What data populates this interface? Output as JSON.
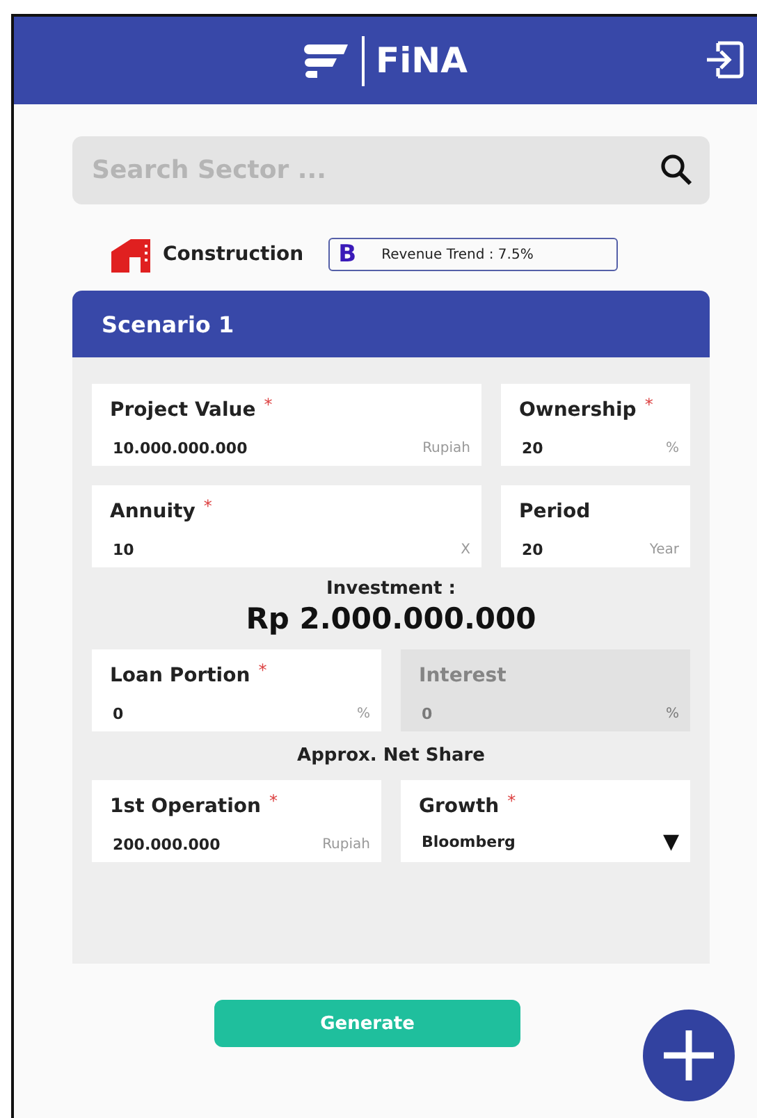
{
  "header": {
    "title": "FiNA"
  },
  "search": {
    "placeholder": "Search Sector ..."
  },
  "sector": {
    "name": "Construction",
    "badge_letter": "B",
    "trend": "Revenue Trend : 7.5%"
  },
  "scenario": {
    "title": "Scenario 1",
    "rows": [
      {
        "kind": "split",
        "fields": [
          {
            "kind": "input",
            "label": "Project Value",
            "marker": "*",
            "value": "10.000.000.000",
            "unit": "Rupiah",
            "disabled": false
          },
          {
            "kind": "input",
            "label": "Ownership",
            "marker": "*",
            "value": "20",
            "unit": "%",
            "disabled": false
          }
        ]
      },
      {
        "kind": "split",
        "fields": [
          {
            "kind": "input",
            "label": "Annuity",
            "marker": "*",
            "value": "10",
            "unit": "X",
            "disabled": false
          },
          {
            "kind": "input",
            "label": "Period",
            "value": "20",
            "unit": "Year",
            "disabled": false
          }
        ]
      },
      {
        "kind": "summary",
        "label": "Investment :",
        "value": "Rp 2.000.000.000"
      },
      {
        "kind": "pair",
        "fields": [
          {
            "kind": "input",
            "label": "Loan Portion",
            "marker": "*",
            "value": "0",
            "unit": "%",
            "disabled": false
          },
          {
            "kind": "input",
            "label": "Interest",
            "value": "0",
            "unit": "%",
            "disabled": true
          }
        ]
      },
      {
        "kind": "heading",
        "label": "Approx. Net Share"
      },
      {
        "kind": "pair",
        "fields": [
          {
            "kind": "input",
            "label": "1st Operation",
            "marker": "*",
            "value": "200.000.000",
            "unit": "Rupiah",
            "disabled": false
          },
          {
            "kind": "select",
            "label": "Growth",
            "marker": "*",
            "value": "Bloomberg",
            "caret": "▼",
            "disabled": false
          }
        ]
      }
    ]
  },
  "generate_button": "Generate"
}
